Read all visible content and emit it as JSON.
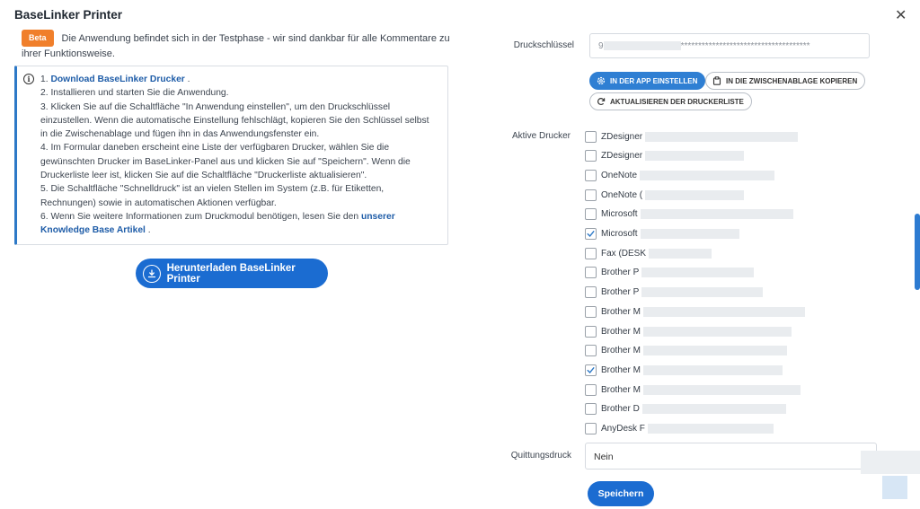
{
  "header": {
    "title": "BaseLinker Printer",
    "close_glyph": "✕"
  },
  "beta": {
    "badge": "Beta",
    "text": "Die Anwendung befindet sich in der Testphase - wir sind dankbar für alle Kommentare zu ihrer Funktionsweise."
  },
  "instructions": {
    "step1_prefix": "1. ",
    "step1_link": "Download BaseLinker Drucker",
    "step1_suffix": " .",
    "step2": "2. Installieren und starten Sie die Anwendung.",
    "step3": "3. Klicken Sie auf die Schaltfläche \"In Anwendung einstellen\", um den Druckschlüssel einzustellen. Wenn die automatische Einstellung fehlschlägt, kopieren Sie den Schlüssel selbst in die Zwischenablage und fügen ihn in das Anwendungsfenster ein.",
    "step4": "4. Im Formular daneben erscheint eine Liste der verfügbaren Drucker, wählen Sie die gewünschten Drucker im BaseLinker-Panel aus und klicken Sie auf \"Speichern\". Wenn die Druckerliste leer ist, klicken Sie auf die Schaltfläche \"Druckerliste aktualisieren\".",
    "step5": "5. Die Schaltfläche \"Schnelldruck\" ist an vielen Stellen im System (z.B. für Etiketten, Rechnungen) sowie in automatischen Aktionen verfügbar.",
    "step6_prefix": "6. Wenn Sie weitere Informationen zum Druckmodul benötigen, lesen Sie den ",
    "step6_link": "unserer Knowledge Base Artikel",
    "step6_suffix": " ."
  },
  "download_button": "Herunterladen BaseLinker Printer",
  "print_key": {
    "label": "Druckschlüssel",
    "value_prefix": "9",
    "value_masked": "*************************************"
  },
  "actions": {
    "set_in_app": "IN DER APP EINSTELLEN",
    "copy_clipboard": "IN DIE ZWISCHENABLAGE KOPIEREN",
    "refresh_list": "AKTUALISIEREN DER DRUCKERLISTE"
  },
  "printers_label": "Aktive Drucker",
  "printers": [
    {
      "name": "ZDesigner",
      "checked": false
    },
    {
      "name": "ZDesigner",
      "checked": false
    },
    {
      "name": "OneNote",
      "checked": false
    },
    {
      "name": "OneNote (",
      "checked": false
    },
    {
      "name": "Microsoft",
      "checked": false
    },
    {
      "name": "Microsoft",
      "checked": true
    },
    {
      "name": "Fax (DESK",
      "checked": false
    },
    {
      "name": "Brother P",
      "checked": false
    },
    {
      "name": "Brother P",
      "checked": false
    },
    {
      "name": "Brother M",
      "checked": false
    },
    {
      "name": "Brother M",
      "checked": false
    },
    {
      "name": "Brother M",
      "checked": false
    },
    {
      "name": "Brother M",
      "checked": true
    },
    {
      "name": "Brother M",
      "checked": false
    },
    {
      "name": "Brother D",
      "checked": false
    },
    {
      "name": "AnyDesk F",
      "checked": false
    }
  ],
  "receipt": {
    "label": "Quittungsdruck",
    "value": "Nein"
  },
  "save_button": "Speichern",
  "colors": {
    "primary": "#1b6cd1",
    "beta": "#f07f2b",
    "link": "#1f5da8"
  }
}
